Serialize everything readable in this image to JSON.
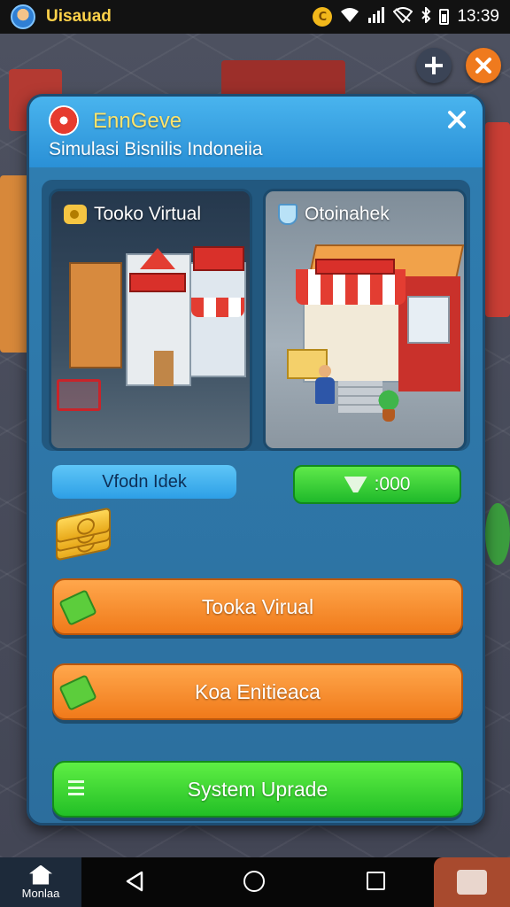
{
  "status_bar": {
    "app_name": "Uisauad",
    "coin_symbol": "C",
    "time": "13:39"
  },
  "dialog": {
    "title": "EnnGeve",
    "subtitle": "Simulasi Bisnilis Indoneiia",
    "close_icon": "close-icon"
  },
  "shops": [
    {
      "label": "Tooko Virtual",
      "icon": "tag-icon"
    },
    {
      "label": "Otoinahek",
      "icon": "cup-icon"
    }
  ],
  "info": {
    "blue_pill": "Vfodn Idek",
    "green_pill": ":000"
  },
  "buttons": {
    "first": "Tooka Virual",
    "second": "Koa Enitieaca",
    "third": "System Uprade"
  },
  "nav": {
    "home_label": "Monlaa"
  },
  "colors": {
    "accent_orange": "#f07a1a",
    "accent_green": "#22bf26",
    "dialog_blue": "#2b6d9c",
    "title_yellow": "#ffe46b"
  }
}
